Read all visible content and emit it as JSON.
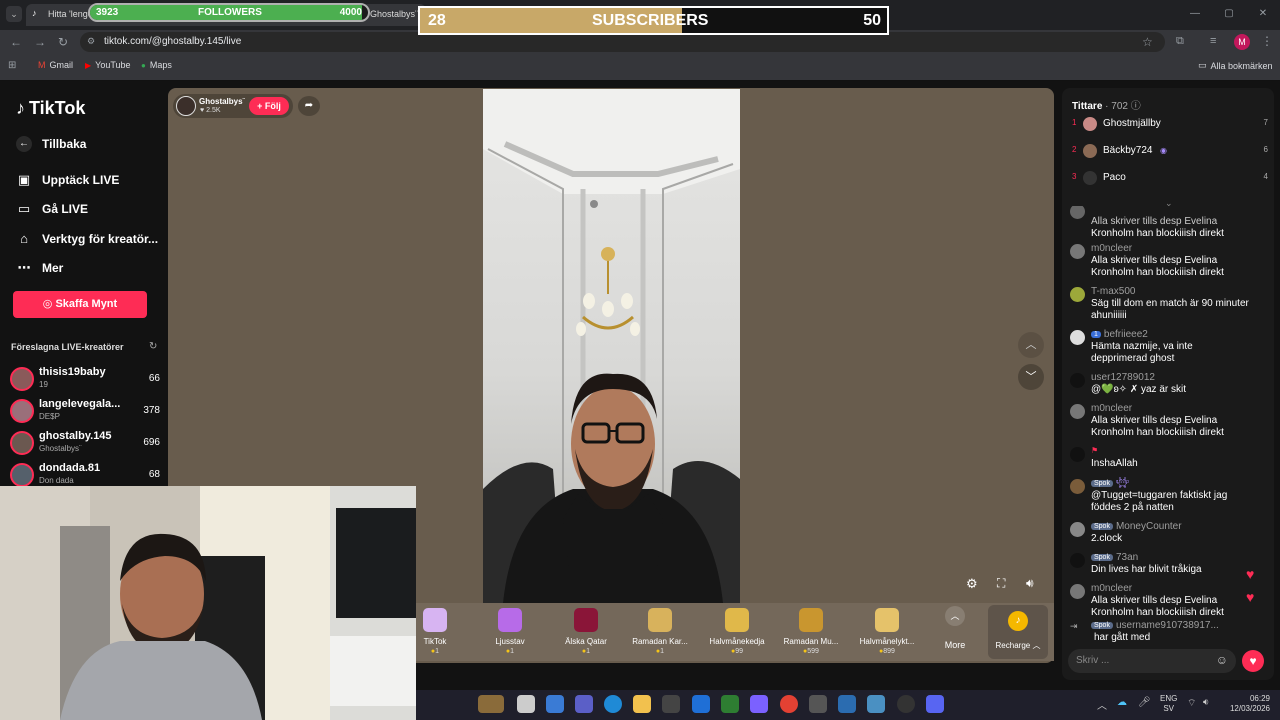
{
  "browser": {
    "tab_title": "Hitta 'lenge",
    "tab_title_2": "Ghostalbys¨ (@",
    "url": "tiktok.com/@ghostalby.145/live",
    "profile_initial": "M",
    "bookmarks": [
      "Gmail",
      "YouTube",
      "Maps"
    ],
    "all_bookmarks": "Alla bokmärken"
  },
  "overlay": {
    "followers": {
      "current": "3923",
      "label": "FOLLOWERS",
      "goal": "4000",
      "progress": 0.98
    },
    "subscribers": {
      "current": "28",
      "label": "SUBSCRIBERS",
      "goal": "50",
      "progress": 0.56
    }
  },
  "sidebar": {
    "logo": "TikTok",
    "back": "Tillbaka",
    "items": [
      {
        "label": "Upptäck LIVE",
        "icon": "calendar-live-icon"
      },
      {
        "label": "Gå LIVE",
        "icon": "camera-icon"
      },
      {
        "label": "Verktyg för kreatör...",
        "icon": "creator-tools-icon"
      },
      {
        "label": "Mer",
        "icon": "more-icon"
      }
    ],
    "coin_button": "Skaffa Mynt",
    "suggested_title": "Föreslagna LIVE-kreatörer",
    "creators": [
      {
        "name": "thisis19baby",
        "sub": "19",
        "count": "66"
      },
      {
        "name": "langelevegala...",
        "sub": "DE$P",
        "count": "378"
      },
      {
        "name": "ghostalby.145",
        "sub": "Ghostalbys¨",
        "count": "696"
      },
      {
        "name": "dondada.81",
        "sub": "Don dada",
        "count": "68"
      }
    ]
  },
  "stream": {
    "host_name": "Ghostalbys¨",
    "host_likes": "2.5K",
    "follow_label": "+ Följ"
  },
  "gifts": [
    {
      "name": "TikTok",
      "price": "1",
      "color": "#d7b4f2"
    },
    {
      "name": "Ljusstav",
      "price": "1",
      "color": "#b76be8"
    },
    {
      "name": "Älska Qatar",
      "price": "1",
      "color": "#8a1538"
    },
    {
      "name": "Ramadan Kar...",
      "price": "1",
      "color": "#d8b25c"
    },
    {
      "name": "Halvmånekedja",
      "price": "99",
      "color": "#e0b84a"
    },
    {
      "name": "Ramadan Mu...",
      "price": "599",
      "color": "#c9962f"
    },
    {
      "name": "Halvmånelykt...",
      "price": "899",
      "color": "#e5c26a"
    }
  ],
  "gift_more": "More",
  "recharge": "Recharge",
  "chat": {
    "viewers_label": "Tittare",
    "viewers_count": "· 702",
    "top_viewers": [
      {
        "rank": "1",
        "name": "Ghostmjällby",
        "score": "7"
      },
      {
        "rank": "2",
        "name": "Bäckby724",
        "score": "6"
      },
      {
        "rank": "3",
        "name": "Paco",
        "score": "4"
      }
    ],
    "messages": [
      {
        "user": "",
        "text": "Alla skriver tills desp Evelina Kronholm han blockiiish direkt",
        "partial": "Alla skriver tills desp Evelina"
      },
      {
        "user": "m0ncleer",
        "text": "Alla skriver tills desp Evelina Kronholm han blockiiish direkt"
      },
      {
        "user": "T-max500",
        "text": "Säg till dom en match är 90 minuter ahuniiiiii"
      },
      {
        "user": "befriieee2",
        "badge": "1",
        "text": "Hämta nazmije, va inte depprimerad ghost"
      },
      {
        "user": "user12789012",
        "text": "@💚ʚ✧ ✗ yaz är skit"
      },
      {
        "user": "m0ncleer",
        "text": "Alla skriver tills desp Evelina Kronholm han blockiiish direkt"
      },
      {
        "user": "",
        "text": "InshaAllah"
      },
      {
        "user": "",
        "badge": "Spok",
        "text": "@Tugget=tuggaren faktiskt jag föddes 2 på natten"
      },
      {
        "user": "MoneyCounter",
        "badge": "Spok",
        "text": "2.clock"
      },
      {
        "user": "73an",
        "badge": "Spok",
        "text": "Din lives har blivit tråkiga"
      },
      {
        "user": "m0ncleer",
        "text": "Alla skriver tills desp Evelina Kronholm han blockiiish direkt"
      },
      {
        "user": "username910738917...",
        "badge": "Spok",
        "text": "har gått med"
      }
    ],
    "input_placeholder": "Skriv ..."
  },
  "taskbar": {
    "lang_top": "ENG",
    "lang_bottom": "SV",
    "time": "06:29",
    "date": "12/03/2026"
  }
}
